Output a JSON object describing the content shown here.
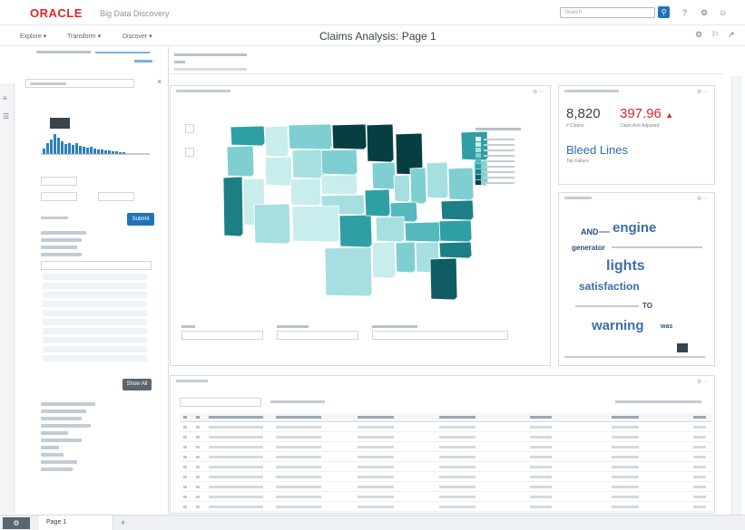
{
  "app": {
    "brand": "ORACLE",
    "product": "Big Data Discovery",
    "brand_color": "#e0252b",
    "accent_color": "#1e74b8"
  },
  "search": {
    "placeholder": "Search"
  },
  "menu": {
    "explore": "Explore",
    "transform": "Transform",
    "discover": "Discover"
  },
  "page": {
    "title": "Claims Analysis: Page 1"
  },
  "left_panel": {
    "apply_label": "Submit",
    "more_label": "Show All"
  },
  "metrics": {
    "claims": "8,820",
    "avg": "397.96",
    "claims_label": "# Claims",
    "avg_label": "Claim Amt Adjusted"
  },
  "bleed": {
    "title": "Bleed Lines",
    "subtitle": "Top Failure"
  },
  "wordcloud": {
    "words": [
      {
        "text": "AND",
        "size": 9,
        "color": "#2e4f7a"
      },
      {
        "text": "engine",
        "size": 15,
        "color": "#3b6ea8"
      },
      {
        "text": "generator",
        "size": 8,
        "color": "#2e4f7a"
      },
      {
        "text": "lights",
        "size": 16,
        "color": "#3b6ea8"
      },
      {
        "text": "satisfaction",
        "size": 12,
        "color": "#3b6ea8"
      },
      {
        "text": "TO",
        "size": 8,
        "color": "#2e4f7a"
      },
      {
        "text": "warning",
        "size": 15,
        "color": "#3b6ea8"
      },
      {
        "text": "was",
        "size": 7,
        "color": "#2e4f7a"
      }
    ]
  },
  "bottom": {
    "tab": "Page 1"
  },
  "map": {
    "palette": [
      "#e7f6f6",
      "#c9ecec",
      "#a6dfe0",
      "#7fcfd2",
      "#53b9bd",
      "#2e9fa5",
      "#1c7f86",
      "#0f5c62",
      "#073e42"
    ]
  }
}
